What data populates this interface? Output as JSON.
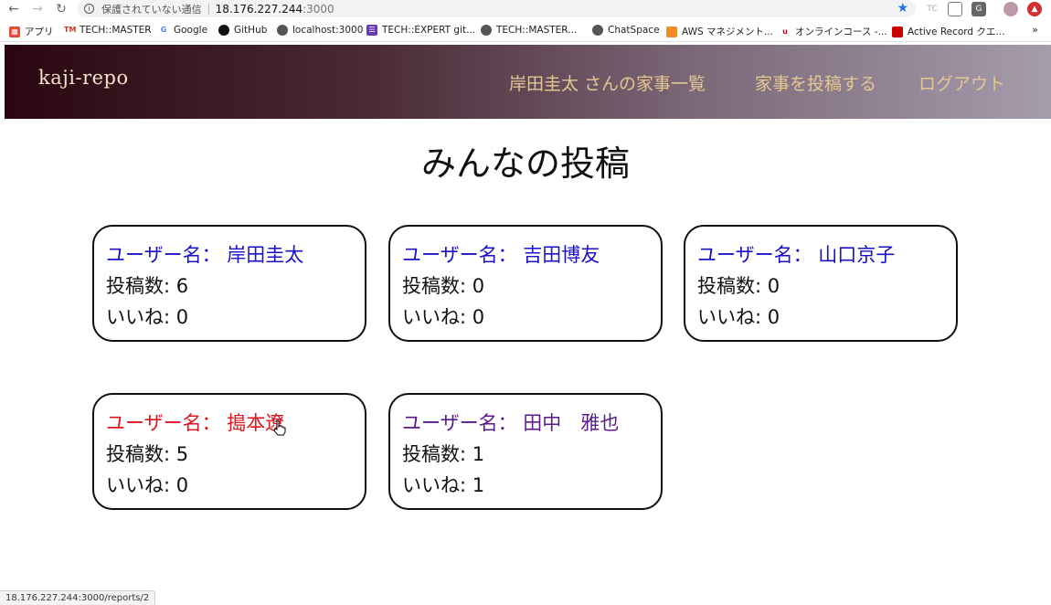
{
  "browser": {
    "security_label": "保護されていない通信",
    "host": "18.176.227.244",
    "port": ":3000",
    "bookmarks": [
      {
        "label": "アプリ",
        "icon": "apps-grid-icon",
        "color": "#e8453c"
      },
      {
        "label": "TECH::MASTER",
        "icon": "techmaster-icon",
        "color": "#c0392b"
      },
      {
        "label": "Google",
        "icon": "google-icon",
        "color": "#4285f4"
      },
      {
        "label": "GitHub",
        "icon": "github-icon",
        "color": "#111111"
      },
      {
        "label": "localhost:3000",
        "icon": "globe-icon",
        "color": "#555555"
      },
      {
        "label": "TECH::EXPERT git...",
        "icon": "doc-icon",
        "color": "#673ab7"
      },
      {
        "label": "TECH::MASTER...",
        "icon": "globe-icon",
        "color": "#555555"
      },
      {
        "label": "ChatSpace",
        "icon": "globe-icon",
        "color": "#555555"
      },
      {
        "label": "AWS マネジメント...",
        "icon": "aws-icon",
        "color": "#f28c28"
      },
      {
        "label": "オンラインコース -...",
        "icon": "udemy-icon",
        "color": "#d0021b"
      },
      {
        "label": "Active Record クエ...",
        "icon": "rails-icon",
        "color": "#cc0000"
      }
    ],
    "status_url": "18.176.227.244:3000/reports/2"
  },
  "header": {
    "logo": "kaji-repo",
    "nav": {
      "my_list": "岸田圭太 さんの家事一覧",
      "post": "家事を投稿する",
      "logout": "ログアウト"
    }
  },
  "main": {
    "title": "みんなの投稿",
    "users": [
      {
        "name_line": "ユーザー名： 岸田圭太",
        "posts_line": "投稿数: 6",
        "likes_line": "いいね: 0",
        "name_color": "#1a10c8"
      },
      {
        "name_line": "ユーザー名： 吉田博友",
        "posts_line": "投稿数: 0",
        "likes_line": "いいね: 0",
        "name_color": "#1a10c8"
      },
      {
        "name_line": "ユーザー名： 山口京子",
        "posts_line": "投稿数: 0",
        "likes_line": "いいね: 0",
        "name_color": "#1a10c8"
      },
      {
        "name_line": "ユーザー名： 搗本遼",
        "posts_line": "投稿数: 5",
        "likes_line": "いいね: 0",
        "name_color": "#e0141e"
      },
      {
        "name_line": "ユーザー名： 田中　雅也",
        "posts_line": "投稿数: 1",
        "likes_line": "いいね: 1",
        "name_color": "#5a1a8c"
      }
    ]
  }
}
